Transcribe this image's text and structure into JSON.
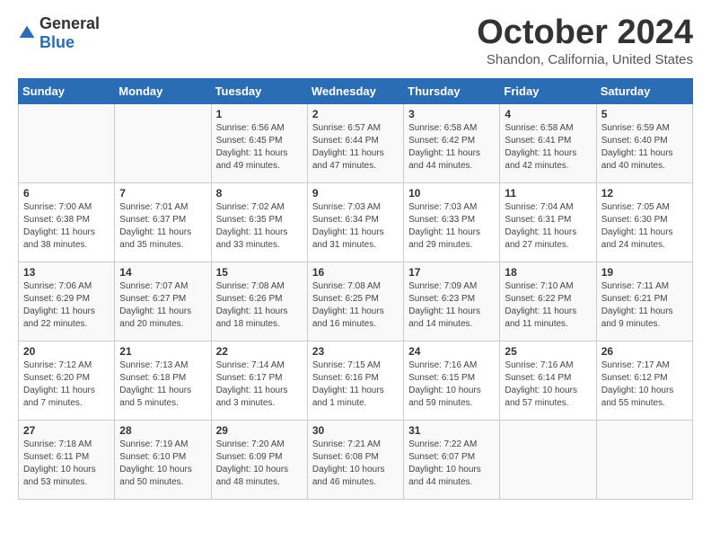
{
  "logo": {
    "text_general": "General",
    "text_blue": "Blue"
  },
  "title": "October 2024",
  "subtitle": "Shandon, California, United States",
  "days_of_week": [
    "Sunday",
    "Monday",
    "Tuesday",
    "Wednesday",
    "Thursday",
    "Friday",
    "Saturday"
  ],
  "weeks": [
    [
      {
        "day": "",
        "info": ""
      },
      {
        "day": "",
        "info": ""
      },
      {
        "day": "1",
        "info": "Sunrise: 6:56 AM\nSunset: 6:45 PM\nDaylight: 11 hours and 49 minutes."
      },
      {
        "day": "2",
        "info": "Sunrise: 6:57 AM\nSunset: 6:44 PM\nDaylight: 11 hours and 47 minutes."
      },
      {
        "day": "3",
        "info": "Sunrise: 6:58 AM\nSunset: 6:42 PM\nDaylight: 11 hours and 44 minutes."
      },
      {
        "day": "4",
        "info": "Sunrise: 6:58 AM\nSunset: 6:41 PM\nDaylight: 11 hours and 42 minutes."
      },
      {
        "day": "5",
        "info": "Sunrise: 6:59 AM\nSunset: 6:40 PM\nDaylight: 11 hours and 40 minutes."
      }
    ],
    [
      {
        "day": "6",
        "info": "Sunrise: 7:00 AM\nSunset: 6:38 PM\nDaylight: 11 hours and 38 minutes."
      },
      {
        "day": "7",
        "info": "Sunrise: 7:01 AM\nSunset: 6:37 PM\nDaylight: 11 hours and 35 minutes."
      },
      {
        "day": "8",
        "info": "Sunrise: 7:02 AM\nSunset: 6:35 PM\nDaylight: 11 hours and 33 minutes."
      },
      {
        "day": "9",
        "info": "Sunrise: 7:03 AM\nSunset: 6:34 PM\nDaylight: 11 hours and 31 minutes."
      },
      {
        "day": "10",
        "info": "Sunrise: 7:03 AM\nSunset: 6:33 PM\nDaylight: 11 hours and 29 minutes."
      },
      {
        "day": "11",
        "info": "Sunrise: 7:04 AM\nSunset: 6:31 PM\nDaylight: 11 hours and 27 minutes."
      },
      {
        "day": "12",
        "info": "Sunrise: 7:05 AM\nSunset: 6:30 PM\nDaylight: 11 hours and 24 minutes."
      }
    ],
    [
      {
        "day": "13",
        "info": "Sunrise: 7:06 AM\nSunset: 6:29 PM\nDaylight: 11 hours and 22 minutes."
      },
      {
        "day": "14",
        "info": "Sunrise: 7:07 AM\nSunset: 6:27 PM\nDaylight: 11 hours and 20 minutes."
      },
      {
        "day": "15",
        "info": "Sunrise: 7:08 AM\nSunset: 6:26 PM\nDaylight: 11 hours and 18 minutes."
      },
      {
        "day": "16",
        "info": "Sunrise: 7:08 AM\nSunset: 6:25 PM\nDaylight: 11 hours and 16 minutes."
      },
      {
        "day": "17",
        "info": "Sunrise: 7:09 AM\nSunset: 6:23 PM\nDaylight: 11 hours and 14 minutes."
      },
      {
        "day": "18",
        "info": "Sunrise: 7:10 AM\nSunset: 6:22 PM\nDaylight: 11 hours and 11 minutes."
      },
      {
        "day": "19",
        "info": "Sunrise: 7:11 AM\nSunset: 6:21 PM\nDaylight: 11 hours and 9 minutes."
      }
    ],
    [
      {
        "day": "20",
        "info": "Sunrise: 7:12 AM\nSunset: 6:20 PM\nDaylight: 11 hours and 7 minutes."
      },
      {
        "day": "21",
        "info": "Sunrise: 7:13 AM\nSunset: 6:18 PM\nDaylight: 11 hours and 5 minutes."
      },
      {
        "day": "22",
        "info": "Sunrise: 7:14 AM\nSunset: 6:17 PM\nDaylight: 11 hours and 3 minutes."
      },
      {
        "day": "23",
        "info": "Sunrise: 7:15 AM\nSunset: 6:16 PM\nDaylight: 11 hours and 1 minute."
      },
      {
        "day": "24",
        "info": "Sunrise: 7:16 AM\nSunset: 6:15 PM\nDaylight: 10 hours and 59 minutes."
      },
      {
        "day": "25",
        "info": "Sunrise: 7:16 AM\nSunset: 6:14 PM\nDaylight: 10 hours and 57 minutes."
      },
      {
        "day": "26",
        "info": "Sunrise: 7:17 AM\nSunset: 6:12 PM\nDaylight: 10 hours and 55 minutes."
      }
    ],
    [
      {
        "day": "27",
        "info": "Sunrise: 7:18 AM\nSunset: 6:11 PM\nDaylight: 10 hours and 53 minutes."
      },
      {
        "day": "28",
        "info": "Sunrise: 7:19 AM\nSunset: 6:10 PM\nDaylight: 10 hours and 50 minutes."
      },
      {
        "day": "29",
        "info": "Sunrise: 7:20 AM\nSunset: 6:09 PM\nDaylight: 10 hours and 48 minutes."
      },
      {
        "day": "30",
        "info": "Sunrise: 7:21 AM\nSunset: 6:08 PM\nDaylight: 10 hours and 46 minutes."
      },
      {
        "day": "31",
        "info": "Sunrise: 7:22 AM\nSunset: 6:07 PM\nDaylight: 10 hours and 44 minutes."
      },
      {
        "day": "",
        "info": ""
      },
      {
        "day": "",
        "info": ""
      }
    ]
  ]
}
